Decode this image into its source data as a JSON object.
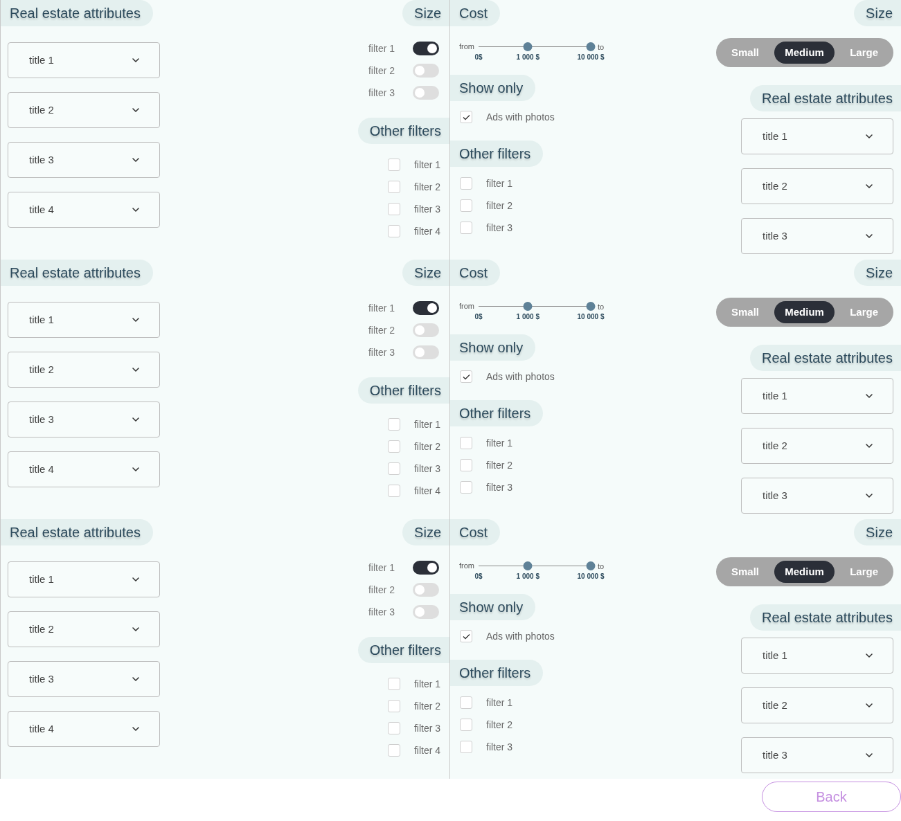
{
  "left_panels": [
    {
      "attributes": {
        "title": "Real estate attributes",
        "dropdowns": [
          "title 1",
          "title 2",
          "title 3",
          "title 4"
        ]
      },
      "size": {
        "title": "Size",
        "toggles": [
          {
            "label": "filter 1",
            "on": true
          },
          {
            "label": "filter 2",
            "on": false
          },
          {
            "label": "filter 3",
            "on": false
          }
        ]
      },
      "other_filters": {
        "title": "Other filters",
        "items": [
          {
            "label": "filter 1",
            "checked": false
          },
          {
            "label": "filter 2",
            "checked": false
          },
          {
            "label": "filter 3",
            "checked": false
          },
          {
            "label": "filter 4",
            "checked": false
          }
        ]
      }
    },
    {
      "attributes": {
        "title": "Real estate attributes",
        "dropdowns": [
          "title 1",
          "title 2",
          "title 3",
          "title 4"
        ]
      },
      "size": {
        "title": "Size",
        "toggles": [
          {
            "label": "filter 1",
            "on": true
          },
          {
            "label": "filter 2",
            "on": false
          },
          {
            "label": "filter 3",
            "on": false
          }
        ]
      },
      "other_filters": {
        "title": "Other filters",
        "items": [
          {
            "label": "filter 1",
            "checked": false
          },
          {
            "label": "filter 2",
            "checked": false
          },
          {
            "label": "filter 3",
            "checked": false
          },
          {
            "label": "filter 4",
            "checked": false
          }
        ]
      }
    },
    {
      "attributes": {
        "title": "Real estate attributes",
        "dropdowns": [
          "title 1",
          "title 2",
          "title 3",
          "title 4"
        ]
      },
      "size": {
        "title": "Size",
        "toggles": [
          {
            "label": "filter 1",
            "on": true
          },
          {
            "label": "filter 2",
            "on": false
          },
          {
            "label": "filter 3",
            "on": false
          }
        ]
      },
      "other_filters": {
        "title": "Other filters",
        "items": [
          {
            "label": "filter 1",
            "checked": false
          },
          {
            "label": "filter 2",
            "checked": false
          },
          {
            "label": "filter 3",
            "checked": false
          },
          {
            "label": "filter 4",
            "checked": false
          }
        ]
      }
    }
  ],
  "right_panels": [
    {
      "cost": {
        "title": "Cost",
        "from_label": "from",
        "to_label": "to",
        "min_value": "0$",
        "thumbs": [
          {
            "level": 0.44,
            "value": "1 000 $"
          },
          {
            "level": 1,
            "value": "10 000 $"
          }
        ]
      },
      "show_only": {
        "title": "Show only",
        "items": [
          {
            "label": "Ads with photos",
            "checked": true
          }
        ]
      },
      "other_filters": {
        "title": "Other filters",
        "items": [
          {
            "label": "filter 1",
            "checked": false
          },
          {
            "label": "filter 2",
            "checked": false
          },
          {
            "label": "filter 3",
            "checked": false
          }
        ]
      },
      "size": {
        "title": "Size",
        "options": [
          {
            "label": "Small",
            "selected": false
          },
          {
            "label": "Medium",
            "selected": true
          },
          {
            "label": "Large",
            "selected": false
          }
        ]
      },
      "attributes": {
        "title": "Real estate attributes",
        "dropdowns": [
          "title 1",
          "title 2",
          "title 3"
        ]
      }
    },
    {
      "cost": {
        "title": "Cost",
        "from_label": "from",
        "to_label": "to",
        "min_value": "0$",
        "thumbs": [
          {
            "level": 0.44,
            "value": "1 000 $"
          },
          {
            "level": 1,
            "value": "10 000 $"
          }
        ]
      },
      "show_only": {
        "title": "Show only",
        "items": [
          {
            "label": "Ads with photos",
            "checked": true
          }
        ]
      },
      "other_filters": {
        "title": "Other filters",
        "items": [
          {
            "label": "filter 1",
            "checked": false
          },
          {
            "label": "filter 2",
            "checked": false
          },
          {
            "label": "filter 3",
            "checked": false
          }
        ]
      },
      "size": {
        "title": "Size",
        "options": [
          {
            "label": "Small",
            "selected": false
          },
          {
            "label": "Medium",
            "selected": true
          },
          {
            "label": "Large",
            "selected": false
          }
        ]
      },
      "attributes": {
        "title": "Real estate attributes",
        "dropdowns": [
          "title 1",
          "title 2",
          "title 3"
        ]
      }
    },
    {
      "cost": {
        "title": "Cost",
        "from_label": "from",
        "to_label": "to",
        "min_value": "0$",
        "thumbs": [
          {
            "level": 0.44,
            "value": "1 000 $"
          },
          {
            "level": 1,
            "value": "10 000 $"
          }
        ]
      },
      "show_only": {
        "title": "Show only",
        "items": [
          {
            "label": "Ads with photos",
            "checked": true
          }
        ]
      },
      "other_filters": {
        "title": "Other filters",
        "items": [
          {
            "label": "filter 1",
            "checked": false
          },
          {
            "label": "filter 2",
            "checked": false
          },
          {
            "label": "filter 3",
            "checked": false
          }
        ]
      },
      "size": {
        "title": "Size",
        "options": [
          {
            "label": "Small",
            "selected": false
          },
          {
            "label": "Medium",
            "selected": true
          },
          {
            "label": "Large",
            "selected": false
          }
        ]
      },
      "attributes": {
        "title": "Real estate attributes",
        "dropdowns": [
          "title 1",
          "title 2",
          "title 3"
        ]
      }
    }
  ],
  "back_button": "Back"
}
